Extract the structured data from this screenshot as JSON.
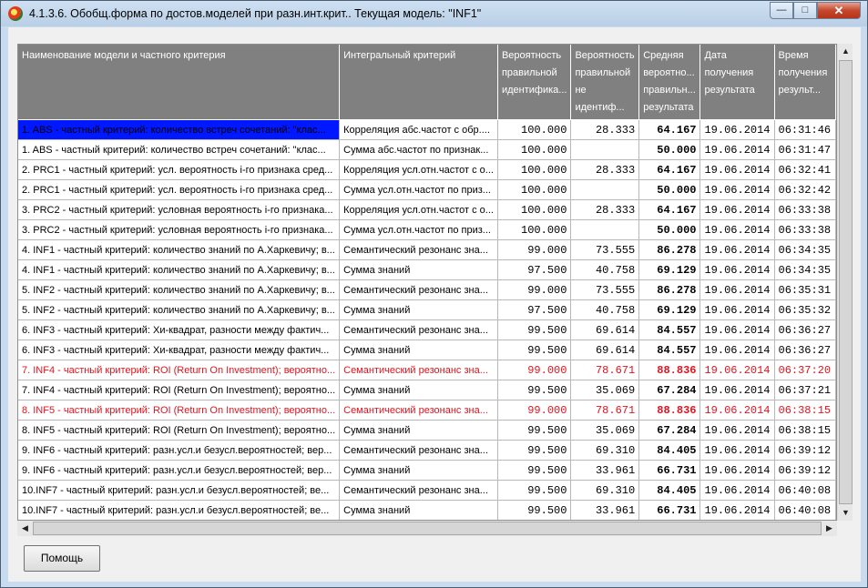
{
  "window": {
    "title": "4.1.3.6. Обобщ.форма по достов.моделей при разн.инт.крит.. Текущая модель: \"INF1\"",
    "min_glyph": "—",
    "max_glyph": "□",
    "close_glyph": "✕"
  },
  "table": {
    "headers": [
      "Наименование модели и частного критерия",
      "Интегральный критерий",
      "Вероятность правильной идентифика...",
      "Вероятность правильной не идентиф...",
      "Средняя вероятно... правильн... результата",
      "Дата получения результата",
      "Время получения результ..."
    ],
    "rows": [
      [
        "1. ABS  - частный критерий: количество встреч сочетаний: \"клас...",
        "Корреляция абс.частот с обр....",
        "100.000",
        "28.333",
        "64.167",
        "19.06.2014",
        "06:31:46"
      ],
      [
        "1. ABS  - частный критерий: количество встреч сочетаний: \"клас...",
        "Сумма абс.частот по признак...",
        "100.000",
        "",
        "50.000",
        "19.06.2014",
        "06:31:47"
      ],
      [
        "2. PRC1 - частный критерий: усл. вероятность i-го признака сред...",
        "Корреляция усл.отн.частот с о...",
        "100.000",
        "28.333",
        "64.167",
        "19.06.2014",
        "06:32:41"
      ],
      [
        "2. PRC1 - частный критерий: усл. вероятность i-го признака сред...",
        "Сумма усл.отн.частот по приз...",
        "100.000",
        "",
        "50.000",
        "19.06.2014",
        "06:32:42"
      ],
      [
        "3. PRC2 - частный критерий: условная вероятность i-го признака...",
        "Корреляция усл.отн.частот с о...",
        "100.000",
        "28.333",
        "64.167",
        "19.06.2014",
        "06:33:38"
      ],
      [
        "3. PRC2 - частный критерий: условная вероятность i-го признака...",
        "Сумма усл.отн.частот по приз...",
        "100.000",
        "",
        "50.000",
        "19.06.2014",
        "06:33:38"
      ],
      [
        "4. INF1 - частный критерий: количество знаний по А.Харкевичу; в...",
        "Семантический резонанс зна...",
        "99.000",
        "73.555",
        "86.278",
        "19.06.2014",
        "06:34:35"
      ],
      [
        "4. INF1 - частный критерий: количество знаний по А.Харкевичу; в...",
        "Сумма знаний",
        "97.500",
        "40.758",
        "69.129",
        "19.06.2014",
        "06:34:35"
      ],
      [
        "5. INF2 - частный критерий: количество знаний по А.Харкевичу; в...",
        "Семантический резонанс зна...",
        "99.000",
        "73.555",
        "86.278",
        "19.06.2014",
        "06:35:31"
      ],
      [
        "5. INF2 - частный критерий: количество знаний по А.Харкевичу; в...",
        "Сумма знаний",
        "97.500",
        "40.758",
        "69.129",
        "19.06.2014",
        "06:35:32"
      ],
      [
        "6. INF3 - частный критерий: Хи-квадрат, разности между фактич...",
        "Семантический резонанс зна...",
        "99.500",
        "69.614",
        "84.557",
        "19.06.2014",
        "06:36:27"
      ],
      [
        "6. INF3 - частный критерий: Хи-квадрат, разности между фактич...",
        "Сумма знаний",
        "99.500",
        "69.614",
        "84.557",
        "19.06.2014",
        "06:36:27"
      ],
      [
        "7. INF4 - частный критерий: ROI (Return On Investment); вероятно...",
        "Семантический резонанс зна...",
        "99.000",
        "78.671",
        "88.836",
        "19.06.2014",
        "06:37:20"
      ],
      [
        "7. INF4 - частный критерий: ROI (Return On Investment); вероятно...",
        "Сумма знаний",
        "99.500",
        "35.069",
        "67.284",
        "19.06.2014",
        "06:37:21"
      ],
      [
        "8. INF5 - частный критерий: ROI (Return On Investment); вероятно...",
        "Семантический резонанс зна...",
        "99.000",
        "78.671",
        "88.836",
        "19.06.2014",
        "06:38:15"
      ],
      [
        "8. INF5 - частный критерий: ROI (Return On Investment); вероятно...",
        "Сумма знаний",
        "99.500",
        "35.069",
        "67.284",
        "19.06.2014",
        "06:38:15"
      ],
      [
        "9. INF6 - частный критерий: разн.усл.и безусл.вероятностей; вер...",
        "Семантический резонанс зна...",
        "99.500",
        "69.310",
        "84.405",
        "19.06.2014",
        "06:39:12"
      ],
      [
        "9. INF6 - частный критерий: разн.усл.и безусл.вероятностей; вер...",
        "Сумма знаний",
        "99.500",
        "33.961",
        "66.731",
        "19.06.2014",
        "06:39:12"
      ],
      [
        "10.INF7 - частный критерий: разн.усл.и безусл.вероятностей; ве...",
        "Семантический резонанс зна...",
        "99.500",
        "69.310",
        "84.405",
        "19.06.2014",
        "06:40:08"
      ],
      [
        "10.INF7 - частный критерий: разн.усл.и безусл.вероятностей; ве...",
        "Сумма знаний",
        "99.500",
        "33.961",
        "66.731",
        "19.06.2014",
        "06:40:08"
      ]
    ],
    "red_rows": [
      12,
      14
    ],
    "selected_row": 0,
    "highlight_color": "#e0141e",
    "selection_color": "#0018ff"
  },
  "buttons": {
    "help": "Помощь"
  },
  "scroll": {
    "up": "▲",
    "down": "▼",
    "left": "◀",
    "right": "▶"
  }
}
